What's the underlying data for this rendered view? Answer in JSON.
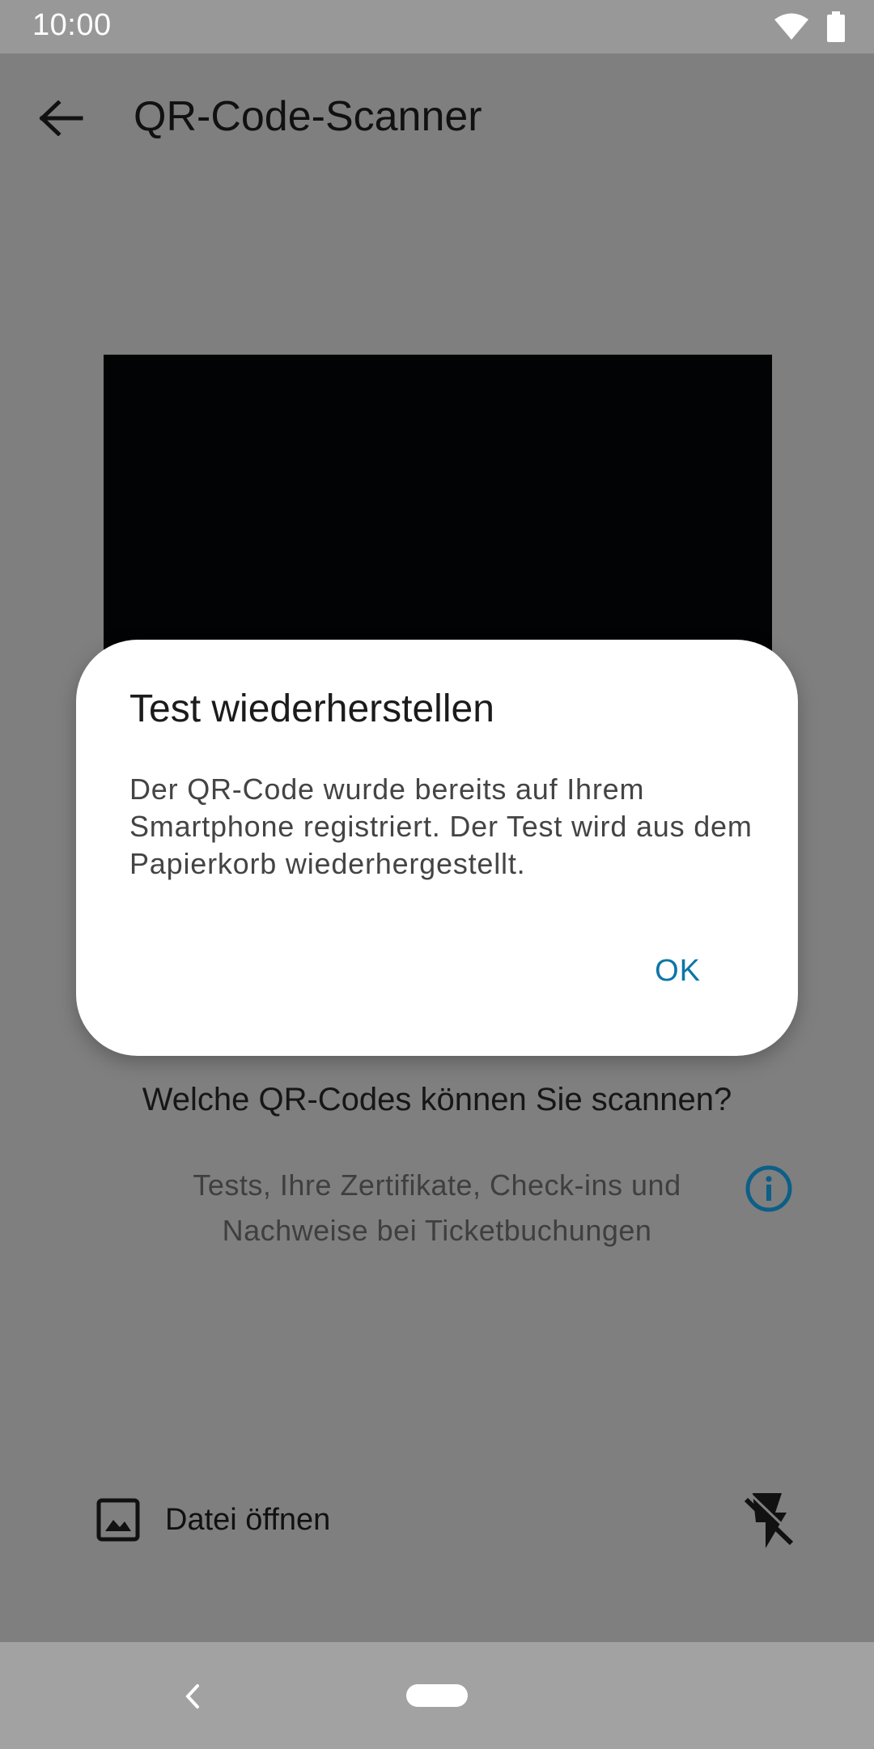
{
  "status_bar": {
    "time": "10:00",
    "icons": [
      "wifi-icon",
      "battery-icon"
    ]
  },
  "app_bar": {
    "title": "QR-Code-Scanner",
    "back_icon": "arrow-back-icon"
  },
  "info": {
    "heading": "Welche QR-Codes können Sie scannen?",
    "text": "Tests, Ihre Zertifikate, Check-ins und Nachweise bei Ticketbuchungen",
    "icon": "info-icon"
  },
  "actions": {
    "open_file_label": "Datei öffnen",
    "open_file_icon": "image-icon",
    "flash_icon": "flash-off-icon"
  },
  "dialog": {
    "title": "Test wiederherstellen",
    "message": "Der QR-Code wurde bereits auf Ihrem Smartphone registriert. Der Test wird aus dem Papierkorb wiederhergestellt.",
    "ok_label": "OK"
  },
  "colors": {
    "accent": "#0c76a6",
    "scrim_background": "#7f7f7f",
    "dialog_background": "#ffffff",
    "camera_preview": "#020305"
  }
}
